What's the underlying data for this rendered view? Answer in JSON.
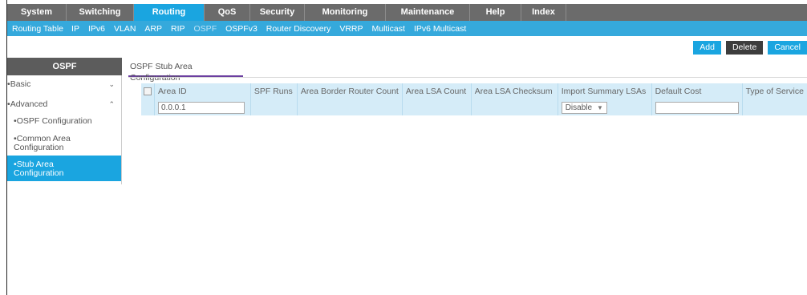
{
  "top_nav": [
    {
      "label": "System",
      "active": false
    },
    {
      "label": "Switching",
      "active": false
    },
    {
      "label": "Routing",
      "active": true
    },
    {
      "label": "QoS",
      "active": false
    },
    {
      "label": "Security",
      "active": false
    },
    {
      "label": "Monitoring",
      "active": false
    },
    {
      "label": "Maintenance",
      "active": false
    },
    {
      "label": "Help",
      "active": false
    },
    {
      "label": "Index",
      "active": false
    }
  ],
  "sub_nav": [
    {
      "label": "Routing Table",
      "active": false
    },
    {
      "label": "IP",
      "active": false
    },
    {
      "label": "IPv6",
      "active": false
    },
    {
      "label": "VLAN",
      "active": false
    },
    {
      "label": "ARP",
      "active": false
    },
    {
      "label": "RIP",
      "active": false
    },
    {
      "label": "OSPF",
      "active": true
    },
    {
      "label": "OSPFv3",
      "active": false
    },
    {
      "label": "Router Discovery",
      "active": false
    },
    {
      "label": "VRRP",
      "active": false
    },
    {
      "label": "Multicast",
      "active": false
    },
    {
      "label": "IPv6 Multicast",
      "active": false
    }
  ],
  "actions": {
    "add": "Add",
    "delete": "Delete",
    "cancel": "Cancel"
  },
  "sidebar": {
    "title": "OSPF",
    "basic": "Basic",
    "advanced": "Advanced",
    "items": [
      {
        "label": "OSPF Configuration",
        "active": false
      },
      {
        "label": "Common Area Configuration",
        "active": false
      },
      {
        "label": "Stub Area Configuration",
        "active": true
      }
    ]
  },
  "content": {
    "tab_title": "OSPF Stub Area Configuration",
    "columns": [
      "Area ID",
      "SPF Runs",
      "Area Border Router Count",
      "Area LSA Count",
      "Area LSA Checksum",
      "Import Summary LSAs",
      "Default Cost",
      "Type of Service"
    ],
    "row": {
      "area_id": "0.0.0.1",
      "import_summary": "Disable",
      "default_cost": ""
    }
  },
  "colors": {
    "accent": "#1aa5e0",
    "subnav": "#35a9dc",
    "topnav": "#6b6b6b",
    "table_bg": "#d5ecf8",
    "tab_underline": "#6b3fa0"
  }
}
